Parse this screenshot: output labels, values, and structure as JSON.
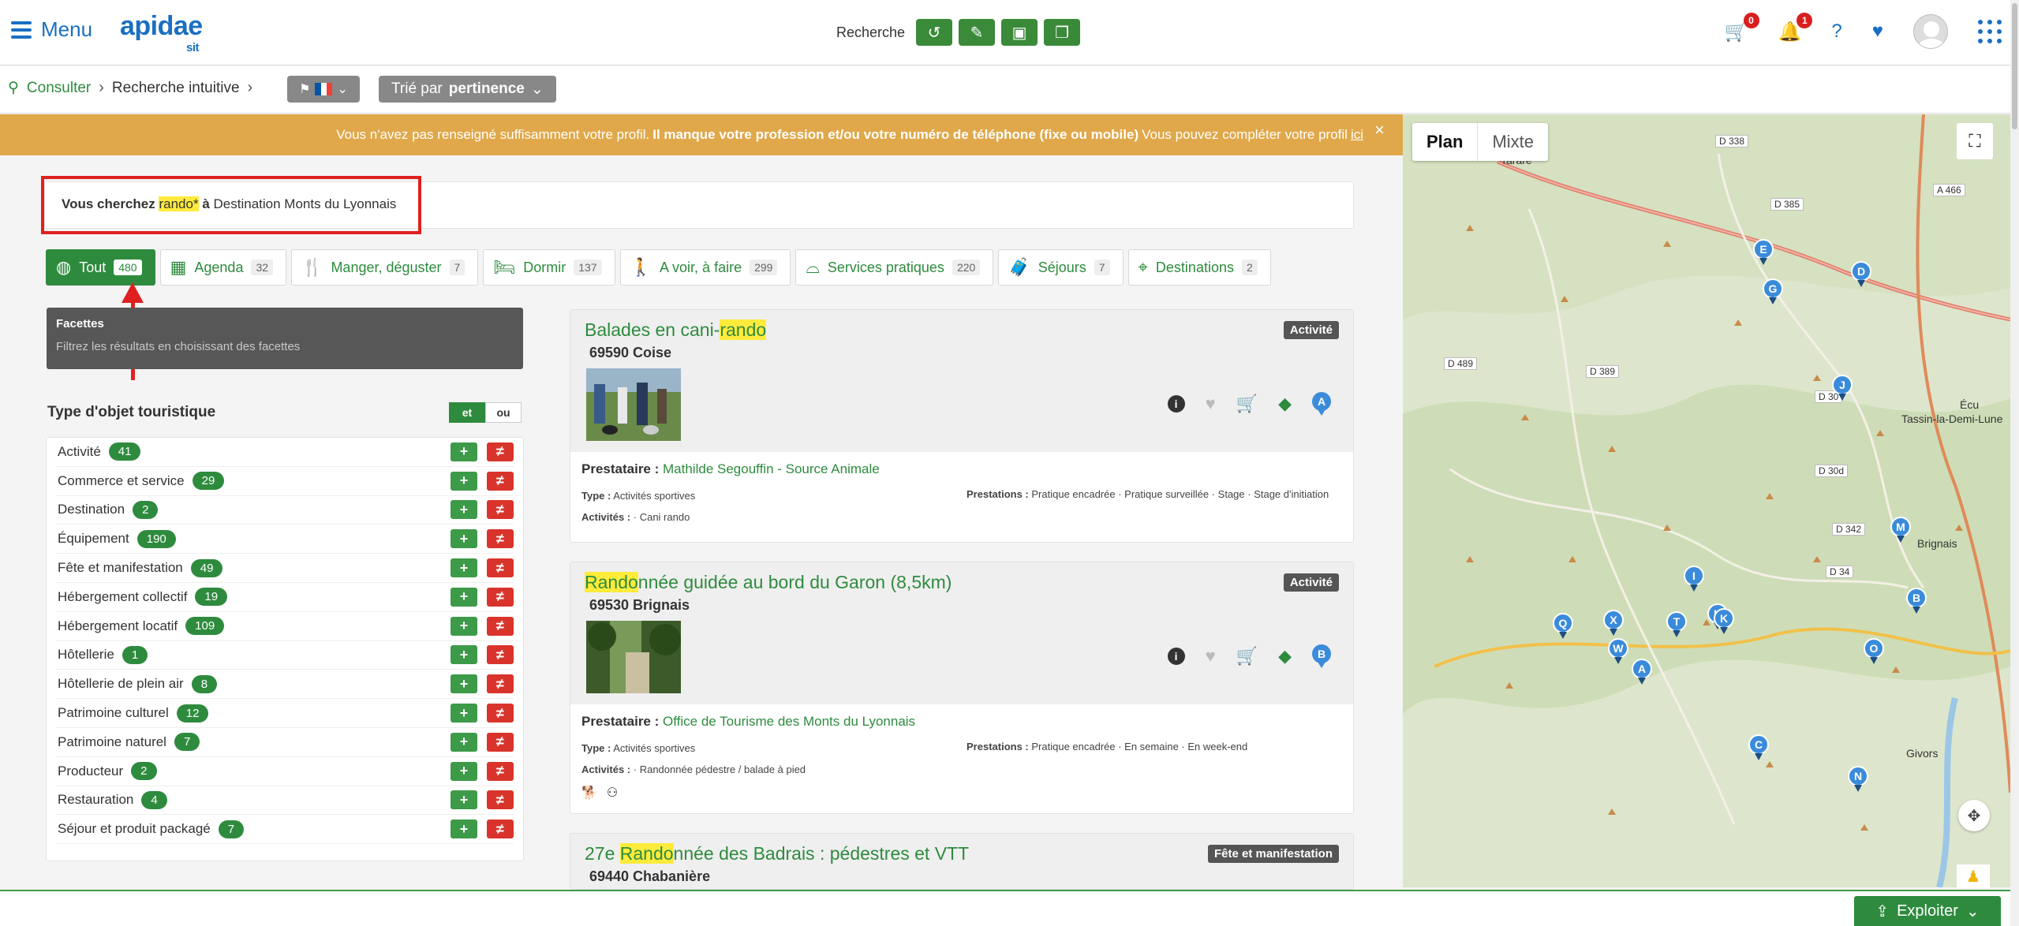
{
  "header": {
    "menu_label": "Menu",
    "logo_text": "apidae",
    "logo_sub": "sit",
    "search_label": "Recherche",
    "cart_count": "0",
    "notif_count": "1",
    "help_label": "?"
  },
  "breadcrumb": {
    "items": [
      "Consulter",
      "Recherche intuitive"
    ]
  },
  "sort": {
    "prefix": "Trié par",
    "value": "pertinence"
  },
  "banner": {
    "part1": "Vous n'avez pas renseigné suffisamment votre profil.",
    "part2": "Il manque votre profession et/ou votre numéro de téléphone (fixe ou mobile)",
    "part3": "Vous pouvez compléter votre profil",
    "link": "ici",
    "close": "×"
  },
  "summary": {
    "prefix": "Vous cherchez",
    "term": "rando*",
    "joiner": "à",
    "place": "Destination Monts du Lyonnais"
  },
  "tabs": [
    {
      "label": "Tout",
      "count": "480",
      "icon": "globe-icon"
    },
    {
      "label": "Agenda",
      "count": "32",
      "icon": "calendar-icon"
    },
    {
      "label": "Manger, déguster",
      "count": "7",
      "icon": "fork-knife-icon"
    },
    {
      "label": "Dormir",
      "count": "137",
      "icon": "bed-icon"
    },
    {
      "label": "A voir, à faire",
      "count": "299",
      "icon": "walker-icon"
    },
    {
      "label": "Services pratiques",
      "count": "220",
      "icon": "bell-service-icon"
    },
    {
      "label": "Séjours",
      "count": "7",
      "icon": "suitcase-icon"
    },
    {
      "label": "Destinations",
      "count": "2",
      "icon": "map-pin-icon"
    }
  ],
  "facettes": {
    "title": "Facettes",
    "subtitle": "Filtrez les résultats en choisissant des facettes"
  },
  "type_section": {
    "title": "Type d'objet touristique",
    "and_label": "et",
    "or_label": "ou",
    "items": [
      {
        "name": "Activité",
        "count": "41"
      },
      {
        "name": "Commerce et service",
        "count": "29"
      },
      {
        "name": "Destination",
        "count": "2"
      },
      {
        "name": "Équipement",
        "count": "190"
      },
      {
        "name": "Fête et manifestation",
        "count": "49"
      },
      {
        "name": "Hébergement collectif",
        "count": "19"
      },
      {
        "name": "Hébergement locatif",
        "count": "109"
      },
      {
        "name": "Hôtellerie",
        "count": "1"
      },
      {
        "name": "Hôtellerie de plein air",
        "count": "8"
      },
      {
        "name": "Patrimoine culturel",
        "count": "12"
      },
      {
        "name": "Patrimoine naturel",
        "count": "7"
      },
      {
        "name": "Producteur",
        "count": "2"
      },
      {
        "name": "Restauration",
        "count": "4"
      },
      {
        "name": "Séjour et produit packagé",
        "count": "7"
      }
    ]
  },
  "results": [
    {
      "title_pre": "Balades en cani-",
      "title_hl": "rando",
      "title_post": "",
      "city": "69590 Coise",
      "type": "Activité",
      "marker": "A",
      "provider_label": "Prestataire :",
      "provider": "Mathilde Segouffin - Source Animale",
      "type_line_label": "Type :",
      "type_line": "Activités sportives",
      "activities_label": "Activités :",
      "activities": "Cani rando",
      "prestations_label": "Prestations :",
      "prestations": "Pratique encadrée · Pratique surveillée · Stage · Stage d'initiation"
    },
    {
      "title_pre": "",
      "title_hl": "Rando",
      "title_post": "nnée guidée au bord du Garon (8,5km)",
      "city": "69530 Brignais",
      "type": "Activité",
      "marker": "B",
      "provider_label": "Prestataire :",
      "provider": "Office de Tourisme des Monts du Lyonnais",
      "type_line_label": "Type :",
      "type_line": "Activités sportives",
      "activities_label": "Activités :",
      "activities": "Randonnée pédestre / balade à pied",
      "prestations_label": "Prestations :",
      "prestations": "Pratique encadrée · En semaine · En week-end"
    },
    {
      "title_pre": "27e ",
      "title_hl": "Rando",
      "title_post": "nnée des Badrais : pédestres et VTT",
      "city": "69440 Chabanière",
      "type": "Fête et manifestation"
    }
  ],
  "map": {
    "tab_plan": "Plan",
    "tab_mixte": "Mixte",
    "labels": [
      "Tarare",
      "D 338",
      "D 385",
      "A 466",
      "D 489",
      "D 389",
      "D 30",
      "D 30d",
      "D 342",
      "D 34",
      "Tassin-la-Demi-Lune",
      "Brignais",
      "Givors",
      "Écu"
    ],
    "markers": [
      "E",
      "G",
      "D",
      "J",
      "M",
      "I",
      "B",
      "Q",
      "X",
      "T",
      "H",
      "K",
      "W",
      "A",
      "O",
      "C",
      "N"
    ]
  },
  "footer": {
    "exploit_label": "Exploiter"
  },
  "colors": {
    "primary_green": "#2e8b3e",
    "brand_blue": "#1a6fc2",
    "banner": "#e0a84a",
    "highlight": "#ffeb3b",
    "annotation_red": "#e02020"
  }
}
